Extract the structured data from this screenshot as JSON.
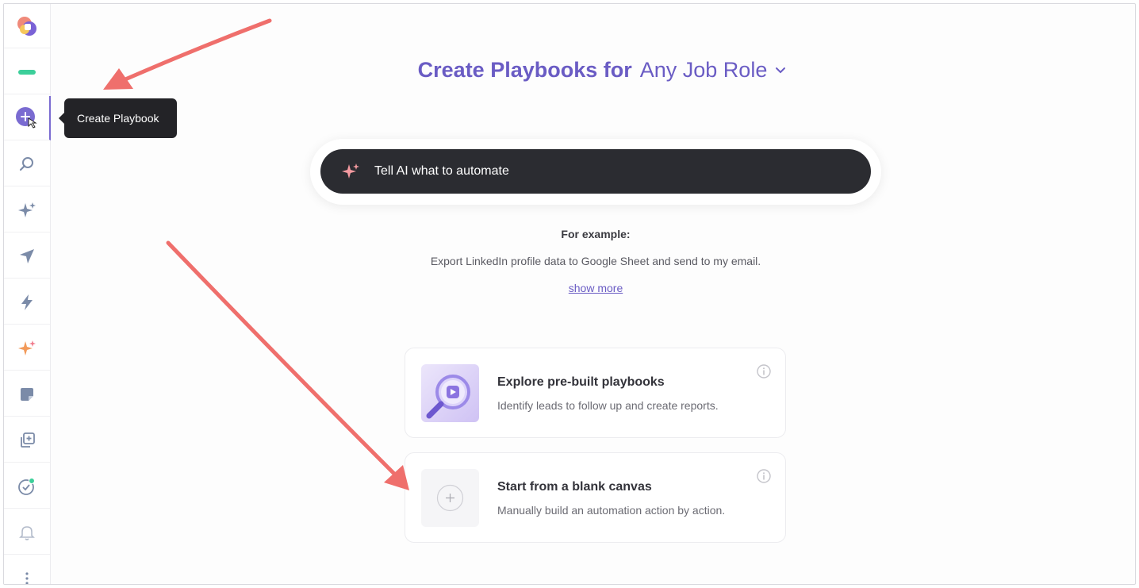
{
  "tooltip": {
    "label": "Create Playbook"
  },
  "heading": {
    "prefix": "Create Playbooks for",
    "role": "Any Job Role"
  },
  "ai_prompt": {
    "label": "Tell AI what to automate"
  },
  "example": {
    "title": "For example:",
    "text": "Export LinkedIn profile data to Google Sheet and send to my email.",
    "show_more": "show more"
  },
  "cards": [
    {
      "title": "Explore pre-built playbooks",
      "description": "Identify leads to follow up and create reports."
    },
    {
      "title": "Start from a blank canvas",
      "description": "Manually build an automation action by action."
    }
  ],
  "colors": {
    "accent": "#6a5cc4",
    "dark": "#2b2c31",
    "annotation_arrow": "#ef6f6c"
  }
}
